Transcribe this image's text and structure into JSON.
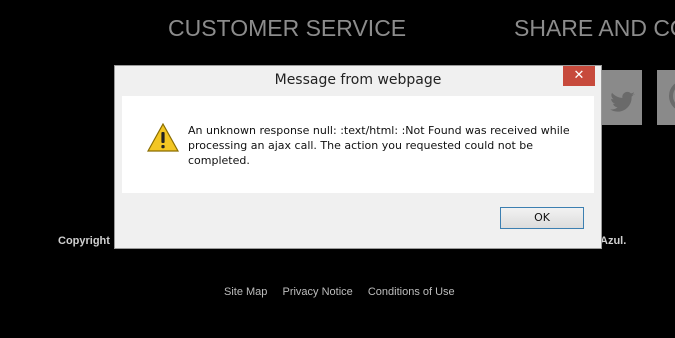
{
  "footer": {
    "heading_customer_service": "CUSTOMER SERVICE",
    "heading_share": "SHARE AND CO",
    "copyright_left": "Copyright",
    "copyright_right": "Azul.",
    "links": [
      "Site Map",
      "Privacy Notice",
      "Conditions of Use"
    ]
  },
  "dialog": {
    "title": "Message from webpage",
    "close_label": "✕",
    "message": "An unknown response null: :text/html: :Not Found was received while processing an ajax call. The action you requested could not be completed.",
    "ok_label": "OK",
    "icon": "warning-icon"
  },
  "colors": {
    "background": "#000000",
    "heading": "#8c8c8c",
    "close_button": "#c74a3c",
    "ok_border": "#3c7fb1"
  }
}
